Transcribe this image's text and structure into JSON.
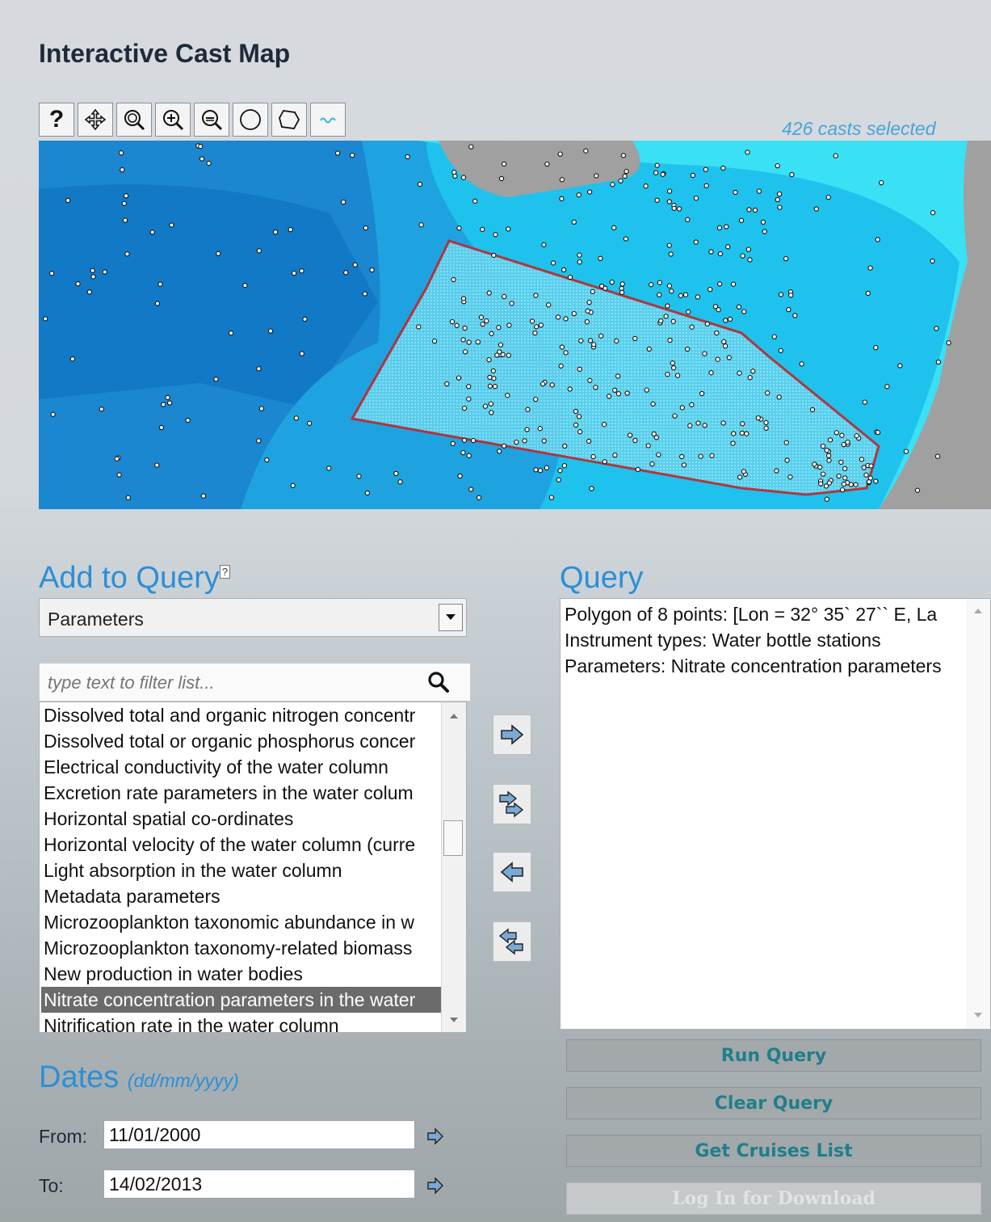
{
  "title": "Interactive Cast Map",
  "toolbar": {
    "tools": [
      {
        "name": "help-tool",
        "icon": "question-icon",
        "label": "?"
      },
      {
        "name": "pan-tool",
        "icon": "move-icon"
      },
      {
        "name": "zoom-extent-tool",
        "icon": "zoom-extent-icon"
      },
      {
        "name": "zoom-in-tool",
        "icon": "zoom-in-icon"
      },
      {
        "name": "zoom-out-tool",
        "icon": "zoom-out-icon"
      },
      {
        "name": "circle-select-tool",
        "icon": "circle-icon"
      },
      {
        "name": "polygon-select-tool",
        "icon": "polygon-icon"
      },
      {
        "name": "line-tool",
        "icon": "line-icon"
      }
    ]
  },
  "casts_selected": "426 casts selected",
  "map": {
    "colors": {
      "deep": "#1a87d0",
      "shallow": "#1fc6ee",
      "coast": "#39e3f4",
      "land": "#a0a0a0",
      "polygon": "#c0282d"
    }
  },
  "add_to_query": {
    "heading": "Add to Query",
    "help_marker": "?",
    "selected_category": "Parameters",
    "filter_placeholder": "type text to filter list...",
    "items": [
      "Dissolved total and organic nitrogen concentr",
      "Dissolved total or organic phosphorus concer",
      "Electrical conductivity of the water column",
      "Excretion rate parameters in the water colum",
      "Horizontal spatial co-ordinates",
      "Horizontal velocity of the water column (curre",
      "Light absorption in the water column",
      "Metadata parameters",
      "Microzooplankton taxonomic abundance in w",
      "Microzooplankton taxonomy-related biomass",
      "New production in water bodies",
      "Nitrate concentration parameters in the water",
      "Nitrification rate in the water column"
    ],
    "selected_index": 11
  },
  "dates": {
    "heading": "Dates",
    "format_hint": "(dd/mm/yyyy)",
    "from_label": "From:",
    "from_value": "11/01/2000",
    "to_label": "To:",
    "to_value": "14/02/2013"
  },
  "query": {
    "heading": "Query",
    "lines": [
      "Polygon of 8 points: [Lon = 32° 35` 27`` E, La",
      "Instrument types: Water bottle stations",
      "Parameters: Nitrate concentration parameters"
    ]
  },
  "buttons": {
    "run": "Run Query",
    "clear": "Clear Query",
    "cruises": "Get Cruises List",
    "login": "Log In for Download"
  }
}
